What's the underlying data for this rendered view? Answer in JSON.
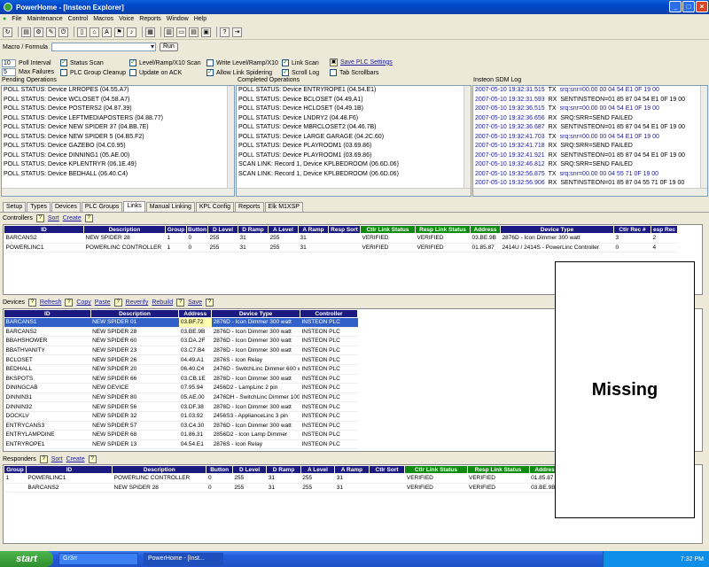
{
  "window": {
    "title": "PowerHome - [Insteon Explorer]"
  },
  "menu": [
    "File",
    "Maintenance",
    "Control",
    "Macros",
    "Voice",
    "Reports",
    "Window",
    "Help"
  ],
  "toolbar_icons": [
    "refresh-icon",
    "explorer-icon",
    "macro-icon",
    "control-icon",
    "power-icon",
    "document-icon",
    "house-icon",
    "spell-icon",
    "flag-icon",
    "note-icon",
    "grid-icon",
    "tile-icon",
    "window-icon",
    "layout-icon",
    "cascade-icon",
    "help-icon",
    "exit-icon"
  ],
  "macro": {
    "label": "Macro / Formula",
    "run_label": "Run"
  },
  "options": {
    "poll_interval": {
      "value": "10",
      "label": "Poll Interval"
    },
    "max_failures": {
      "value": "5",
      "label": "Max Failures"
    },
    "status_scan": "Status Scan",
    "plc_group_cleanup": "PLC Group Cleanup",
    "level_ramp_scan": "Level/Ramp/X10 Scan",
    "update_on_ack": "Update on ACK",
    "write_level_ramp": "Write Level/Ramp/X10",
    "allow_link_spidering": "Allow Link Spidering",
    "link_scan": "Link Scan",
    "scroll_log": "Scroll Log",
    "save_plc_settings": "Save PLC Settings",
    "tab_scrollbars": "Tab Scrollbars"
  },
  "pending": {
    "label": "Pending Operations",
    "lines": [
      "POLL STATUS: Device LRROPES (04.55.A7)",
      "POLL STATUS: Device WCLOSET (04.58.A7)",
      "POLL STATUS: Device POSTERS2 (04.87.39)",
      "POLL STATUS: Device LEFTMEDIAPOSTERS (04.88.77)",
      "POLL STATUS: Device NEW SPIDER 37 (04.BB.7E)",
      "POLL STATUS: Device NEW SPIDER 5 (04.B5.F2)",
      "POLL STATUS: Device GAZEBO (04.C0.95)",
      "POLL STATUS: Device DINNING1 (05.AE.00)",
      "POLL STATUS: Device KPLENTRYR (06.1E.49)",
      "POLL STATUS: Device BEDHALL (06.40.C4)"
    ]
  },
  "completed": {
    "label": "Completed Operations",
    "lines": [
      "POLL STATUS: Device ENTRYROPE1 (04.54.E1)",
      "POLL STATUS: Device BCLOSET (04.49.A1)",
      "POLL STATUS: Device HCLOSET (04.49.1B)",
      "POLL STATUS: Device LNDRY2 (04.48.F6)",
      "POLL STATUS: Device MBRCLOSET2 (04.46.7B)",
      "POLL STATUS: Device LARGE GARAGE (04.2C.60)",
      "POLL STATUS: Device PLAYROOM1 (03.69.86)",
      "POLL STATUS: Device PLAYROOM1 (03.69.86)",
      "SCAN LINK: Record 1, Device KPLBEDROOM (06.6D.06)",
      "SCAN LINK: Record 1, Device KPLBEDROOM (06.6D.06)"
    ]
  },
  "sdm": {
    "label": "Insteon SDM Log",
    "lines": [
      {
        "ts": "2007-05-10 19:32:31.515",
        "dir": "TX",
        "msg": "srq:snr=00.00 00 04 54 E1 0F 19 00",
        "blue": true
      },
      {
        "ts": "2007-05-10 19:32:31.593",
        "dir": "RX",
        "msg": "SENTINSTEON=01 85 87 04 54 E1 0F 19 00",
        "blue": false
      },
      {
        "ts": "2007-05-10 19:32:36.515",
        "dir": "TX",
        "msg": "srq:snr=00.00 00 04 54 E1 0F 19 00",
        "blue": true
      },
      {
        "ts": "2007-05-10 19:32:36.656",
        "dir": "RX",
        "msg": "SRQ:SRR=SEND FAILED",
        "blue": false
      },
      {
        "ts": "2007-05-10 19:32:36.687",
        "dir": "RX",
        "msg": "SENTINSTEON=01 85 87 04 54 E1 0F 19 00",
        "blue": false
      },
      {
        "ts": "2007-05-10 19:32:41.703",
        "dir": "TX",
        "msg": "srq:snr=00.00 00 04 54 E1 0F 19 00",
        "blue": true
      },
      {
        "ts": "2007-05-10 19:32:41.718",
        "dir": "RX",
        "msg": "SRQ:SRR=SEND FAILED",
        "blue": false
      },
      {
        "ts": "2007-05-10 19:32:41.921",
        "dir": "RX",
        "msg": "SENTINSTEON=01 85 87 04 54 E1 0F 19 00",
        "blue": false
      },
      {
        "ts": "2007-05-10 19:32:46.812",
        "dir": "RX",
        "msg": "SRQ:SRR=SEND FAILED",
        "blue": false
      },
      {
        "ts": "2007-05-10 19:32:56.875",
        "dir": "TX",
        "msg": "srq:snr=00.00 00 04 55 71 0F 19 00",
        "blue": true
      },
      {
        "ts": "2007-05-10 19:32:56.906",
        "dir": "RX",
        "msg": "SENTINSTEON=01 85 87 04 55 71 0F 19 00",
        "blue": false
      }
    ]
  },
  "tabs": [
    "Setup",
    "Types",
    "Devices",
    "PLC Groups",
    "Links",
    "Manual Linking",
    "KPL Config",
    "Reports",
    "Elk M1XSP"
  ],
  "active_tab": "Links",
  "controllers": {
    "label": "Controllers",
    "actions": [
      "Sort",
      "Create"
    ],
    "columns": [
      "ID",
      "Description",
      "Group",
      "Button",
      "D Level",
      "D Ramp",
      "A Level",
      "A Ramp",
      "Resp Sort",
      "Ctlr Link Status",
      "Resp Link Status",
      "Address",
      "Device Type",
      "Ctlr Rec #",
      "esp Rec"
    ],
    "rows": [
      [
        "BARCANS2",
        "NEW SPIDER 28",
        "1",
        "0",
        "255",
        "31",
        "255",
        "31",
        "",
        "VERIFIED",
        "VERIFIED",
        "03.BE.9B",
        "2876D - Icon Dimmer 300 watt",
        "3",
        "2"
      ],
      [
        "POWERLINC1",
        "POWERLINC CONTROLLER",
        "1",
        "0",
        "255",
        "31",
        "255",
        "31",
        "",
        "VERIFIED",
        "VERIFIED",
        "01.85.87",
        "2414U / 2414S - PowerLinc Controller",
        "0",
        "4"
      ]
    ]
  },
  "devices": {
    "label": "Devices",
    "actions": [
      "Refresh",
      "Copy",
      "Paste",
      "Reverify",
      "Rebuild",
      "Save"
    ],
    "columns": [
      "ID",
      "Description",
      "Address",
      "Device Type",
      "Controller"
    ],
    "rows": [
      [
        "BARCANS1",
        "NEW SPIDER 01",
        "03.BF.72",
        "2876D - Icon Dimmer 300 watt",
        "INSTEON PLC"
      ],
      [
        "BARCANS2",
        "NEW SPIDER 28",
        "03.BE.9B",
        "2876D - Icon Dimmer 300 watt",
        "INSTEON PLC"
      ],
      [
        "BBAHSHOWER",
        "NEW SPIDER 60",
        "03.DA.2F",
        "2876D - Icon Dimmer 300 watt",
        "INSTEON PLC"
      ],
      [
        "BBATHVANITY",
        "NEW SPIDER 23",
        "03.C7.B4",
        "2876D - Icon Dimmer 300 watt",
        "INSTEON PLC"
      ],
      [
        "BCLOSET",
        "NEW SPIDER 26",
        "04.49.A1",
        "2876S - Icon Relay",
        "INSTEON PLC"
      ],
      [
        "BEDHALL",
        "NEW SPIDER 20",
        "06.40.C4",
        "2476D - SwitchLinc Dimmer 600 watt",
        "INSTEON PLC"
      ],
      [
        "BKSPOTS",
        "NEW SPIDER 66",
        "03.CB.1E",
        "2876D - Icon Dimmer 300 watt",
        "INSTEON PLC"
      ],
      [
        "DININGCAB",
        "NEW DEVICE",
        "07.95.94",
        "2456D2 - LampLinc 2 pin",
        "INSTEON PLC"
      ],
      [
        "DINNIN31",
        "NEW SPIDER 80",
        "05.AE.00",
        "2476DH - SwitchLinc Dimmer 1000 watt",
        "INSTEON PLC"
      ],
      [
        "DINNIN32",
        "NEW SPIDER 56",
        "03.DF.38",
        "2876D - Icon Dimmer 300 watt",
        "INSTEON PLC"
      ],
      [
        "DOCKLV",
        "NEW SPIDER 32",
        "01.03.92",
        "2456S3 - ApplianceLinc 3 pin",
        "INSTEON PLC"
      ],
      [
        "ENTRYCANS3",
        "NEW SPIDER 57",
        "03.C4.30",
        "2876D - Icon Dimmer 300 watt",
        "INSTEON PLC"
      ],
      [
        "ENTRYLAMPDINE",
        "NEW SPIDER 68",
        "01.86.31",
        "2856D2 - Icon Lamp Dimmer",
        "INSTEON PLC"
      ],
      [
        "ENTRYROPE1",
        "NEW SPIDER 13",
        "04.54.E1",
        "2876S - Icon Relay",
        "INSTEON PLC"
      ]
    ]
  },
  "responders": {
    "label": "Responders",
    "actions": [
      "Sort",
      "Create"
    ],
    "columns": [
      "Group",
      "ID",
      "Description",
      "Button",
      "D Level",
      "D Ramp",
      "A Level",
      "A Ramp",
      "Ctlr Sort",
      "Ctlr Link Status",
      "Resp Link Status",
      "Address",
      "Device"
    ],
    "rows": [
      [
        "1",
        "POWERLINC1",
        "POWERLINC CONTROLLER",
        "0",
        "255",
        "31",
        "255",
        "31",
        "",
        "VERIFIED",
        "VERIFIED",
        "01.85.87",
        "2414U / 2414S - Pow"
      ],
      [
        "",
        "BARCANS2",
        "NEW SPIDER 28",
        "0",
        "255",
        "31",
        "255",
        "31",
        "",
        "VERIFIED",
        "VERIFIED",
        "03.BE.9B",
        "2876D - Icon Dimm"
      ]
    ]
  },
  "missing_label": "Missing",
  "taskbar": {
    "start": "start",
    "tasks": [
      "Gr3rr",
      "PowerHome - [Inst..."
    ],
    "time": "7:32 PM"
  }
}
